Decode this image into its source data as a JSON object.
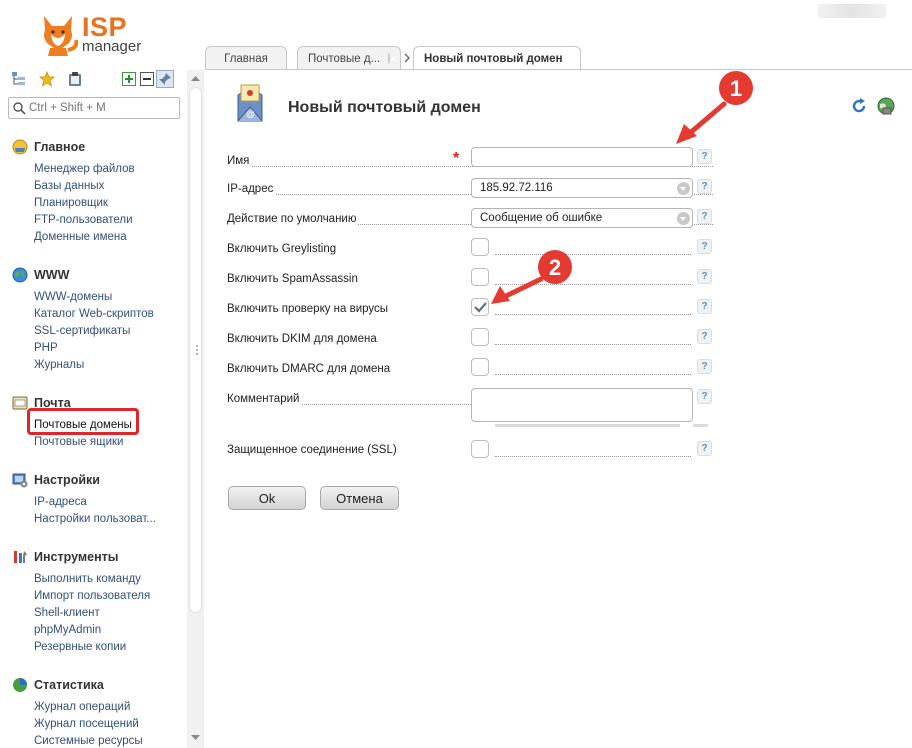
{
  "logo": {
    "brand": "ISP",
    "product": "manager"
  },
  "sidebar": {
    "search": {
      "placeholder": "Ctrl + Shift + M"
    },
    "groups": [
      {
        "title": "Главное",
        "items": [
          "Менеджер файлов",
          "Базы данных",
          "Планировщик",
          "FTP-пользователи",
          "Доменные имена"
        ]
      },
      {
        "title": "WWW",
        "items": [
          "WWW-домены",
          "Каталог Web-скриптов",
          "SSL-сертификаты",
          "PHP",
          "Журналы"
        ]
      },
      {
        "title": "Почта",
        "items": [
          "Почтовые домены",
          "Почтовые ящики"
        ]
      },
      {
        "title": "Настройки",
        "items": [
          "IP-адреса",
          "Настройки пользоват..."
        ]
      },
      {
        "title": "Инструменты",
        "items": [
          "Выполнить команду",
          "Импорт пользователя",
          "Shell-клиент",
          "phpMyAdmin",
          "Резервные копии"
        ]
      },
      {
        "title": "Статистика",
        "items": [
          "Журнал операций",
          "Журнал посещений",
          "Системные ресурсы"
        ]
      }
    ]
  },
  "tabs": [
    {
      "label": "Главная"
    },
    {
      "label": "Почтовые д..."
    },
    {
      "label": "Новый почтовый домен"
    }
  ],
  "form": {
    "title": "Новый почтовый домен",
    "fields": {
      "name": {
        "label": "Имя",
        "value": "",
        "required_mark": "*"
      },
      "ip": {
        "label": "IP-адрес",
        "value": "185.92.72.116"
      },
      "default_action": {
        "label": "Действие по умолчанию",
        "value": "Сообщение об ошибке"
      },
      "greylisting": {
        "label": "Включить Greylisting",
        "checked": false
      },
      "spamassassin": {
        "label": "Включить SpamAssassin",
        "checked": false
      },
      "antivirus": {
        "label": "Включить проверку на вирусы",
        "checked": true
      },
      "dkim": {
        "label": "Включить DKIM для домена",
        "checked": false
      },
      "dmarc": {
        "label": "Включить DMARC для домена",
        "checked": false
      },
      "comment": {
        "label": "Комментарий",
        "value": ""
      },
      "ssl": {
        "label": "Защищенное соединение (SSL)",
        "checked": false
      }
    },
    "help_mark": "?",
    "ok_label": "Ok",
    "cancel_label": "Отмена"
  },
  "annotations": {
    "marker_1": "1",
    "marker_2": "2",
    "color": "#e53a32"
  },
  "colors": {
    "brand_orange": "#e8731f",
    "link": "#33507a",
    "highlight": "#e0262c"
  }
}
